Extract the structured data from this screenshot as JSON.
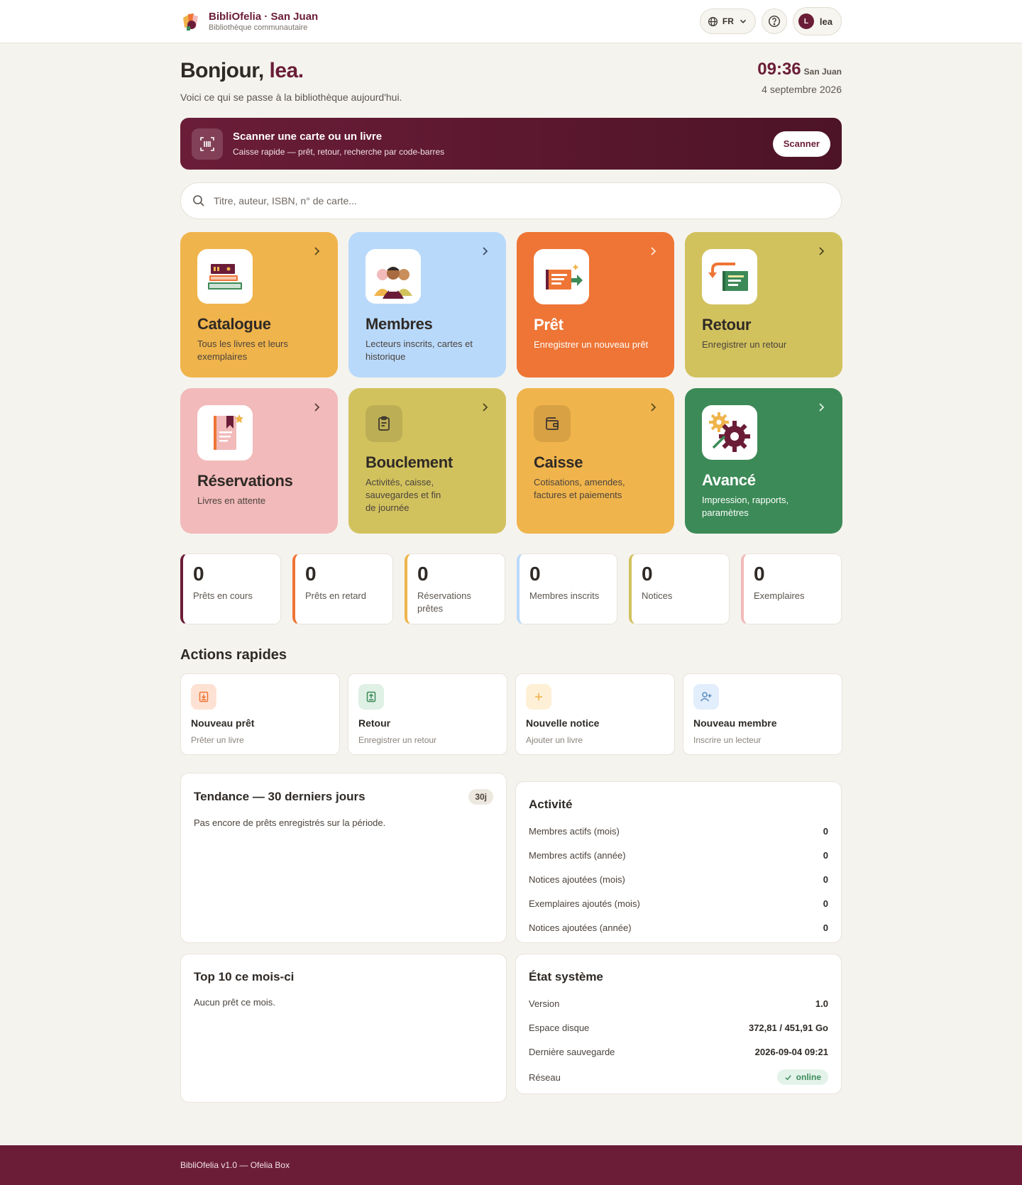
{
  "brand": {
    "name": "BibliOfelia · San Juan",
    "subtitle": "Bibliothèque communautaire"
  },
  "header": {
    "language": "FR",
    "user_initial": "L",
    "user_name": "lea"
  },
  "greeting": {
    "prefix": "Bonjour, ",
    "name": "lea.",
    "subtitle": "Voici ce qui se passe à la bibliothèque aujourd'hui."
  },
  "clock": {
    "time": "09:36",
    "city": "San Juan",
    "date": "4 septembre 2026"
  },
  "scan": {
    "title": "Scanner une carte ou un livre",
    "subtitle": "Caisse rapide — prêt, retour, recherche par code-barres",
    "button": "Scanner"
  },
  "search": {
    "placeholder": "Titre, auteur, ISBN, n° de carte..."
  },
  "tiles": [
    {
      "title": "Catalogue",
      "desc": "Tous les livres et leurs exemplaires",
      "color": "#f0b44c"
    },
    {
      "title": "Membres",
      "desc": "Lecteurs inscrits, cartes et historique",
      "color": "#b9d9fb"
    },
    {
      "title": "Prêt",
      "desc": "Enregistrer un nouveau prêt",
      "color": "#ee7535"
    },
    {
      "title": "Retour",
      "desc": "Enregistrer un retour",
      "color": "#d2c25e"
    },
    {
      "title": "Réservations",
      "desc": "Livres en attente",
      "color": "#f2baba"
    },
    {
      "title": "Bouclement",
      "desc": "Activités, caisse, sauvegardes et fin de journée",
      "color": "#d2c25e"
    },
    {
      "title": "Caisse",
      "desc": "Cotisations, amendes, factures et paiements",
      "color": "#f0b44c"
    },
    {
      "title": "Avancé",
      "desc": "Impression, rapports, paramètres",
      "color": "#3c8a57"
    }
  ],
  "stats": [
    {
      "value": "0",
      "label": "Prêts en cours",
      "color": "#6b1d38"
    },
    {
      "value": "0",
      "label": "Prêts en retard",
      "color": "#ee7535"
    },
    {
      "value": "0",
      "label": "Réservations prêtes",
      "color": "#f0b44c"
    },
    {
      "value": "0",
      "label": "Membres inscrits",
      "color": "#b9d9fb"
    },
    {
      "value": "0",
      "label": "Notices",
      "color": "#d2c25e"
    },
    {
      "value": "0",
      "label": "Exemplaires",
      "color": "#f2baba"
    }
  ],
  "quick_actions": {
    "title": "Actions rapides",
    "items": [
      {
        "title": "Nouveau prêt",
        "sub": "Prêter un livre"
      },
      {
        "title": "Retour",
        "sub": "Enregistrer un retour"
      },
      {
        "title": "Nouvelle notice",
        "sub": "Ajouter un livre"
      },
      {
        "title": "Nouveau membre",
        "sub": "Inscrire un lecteur"
      }
    ]
  },
  "trend": {
    "title": "Tendance — 30 derniers jours",
    "badge": "30j",
    "empty": "Pas encore de prêts enregistrés sur la période."
  },
  "top10": {
    "title": "Top 10 ce mois-ci",
    "empty": "Aucun prêt ce mois."
  },
  "activity": {
    "title": "Activité",
    "rows": [
      {
        "label": "Membres actifs (mois)",
        "value": "0"
      },
      {
        "label": "Membres actifs (année)",
        "value": "0"
      },
      {
        "label": "Notices ajoutées (mois)",
        "value": "0"
      },
      {
        "label": "Exemplaires ajoutés (mois)",
        "value": "0"
      },
      {
        "label": "Notices ajoutées (année)",
        "value": "0"
      }
    ]
  },
  "system": {
    "title": "État système",
    "rows": [
      {
        "label": "Version",
        "value": "1.0"
      },
      {
        "label": "Espace disque",
        "value": "372,81 / 451,91 Go"
      },
      {
        "label": "Dernière sauvegarde",
        "value": "2026-09-04 09:21"
      }
    ],
    "network_label": "Réseau",
    "network_value": "online"
  },
  "footer": {
    "text": "BibliOfelia v1.0 — Ofelia Box"
  }
}
